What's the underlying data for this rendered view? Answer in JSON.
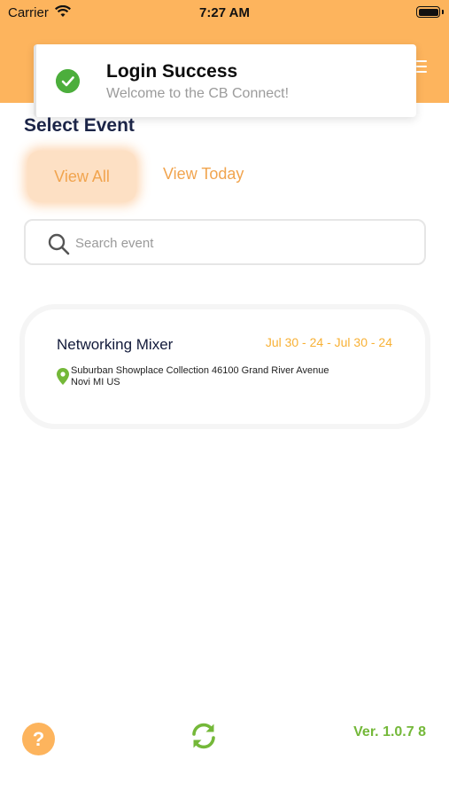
{
  "status_bar": {
    "carrier": "Carrier",
    "time": "7:27 AM"
  },
  "toast": {
    "title": "Login Success",
    "message": "Welcome to the CB Connect!"
  },
  "page": {
    "title": "Select Event"
  },
  "tabs": [
    {
      "label": "View All",
      "selected": true
    },
    {
      "label": "View Today",
      "selected": false
    }
  ],
  "search": {
    "placeholder": "Search event",
    "value": ""
  },
  "events": [
    {
      "name": "Networking Mixer",
      "date": "Jul 30 - 24 - Jul 30 - 24",
      "address": "Suburban Showplace Collection 46100 Grand River Avenue Novi MI US"
    }
  ],
  "footer": {
    "help_label": "?",
    "version": "Ver. 1.0.7 8"
  },
  "colors": {
    "header": "#fdb45d",
    "accent": "#f1a44e",
    "success": "#4cae3c",
    "version": "#74b839"
  }
}
